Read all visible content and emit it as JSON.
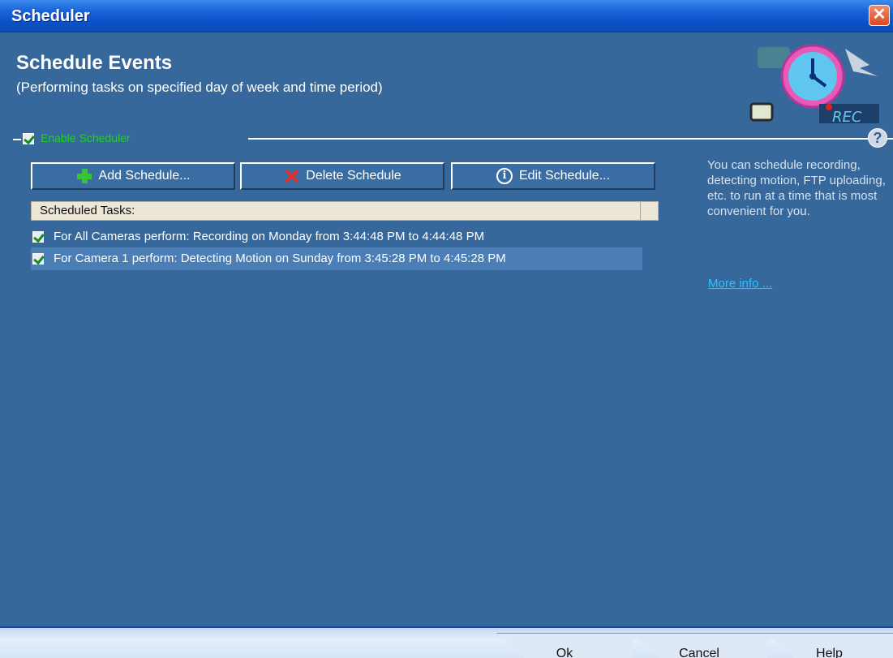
{
  "window": {
    "title": "Scheduler",
    "close_label": "✕"
  },
  "header": {
    "title": "Schedule Events",
    "subtitle": "(Performing tasks on specified day of week and time period)",
    "art_badge": "REC"
  },
  "enable_scheduler": {
    "label": "Enable Scheduler",
    "checked": true
  },
  "toolbar": {
    "add_label": "Add Schedule...",
    "delete_label": "Delete Schedule",
    "edit_label": "Edit Schedule..."
  },
  "task_list": {
    "header": "Scheduled Tasks:",
    "items": [
      {
        "text": "For All Cameras perform: Recording on Monday from 3:44:48 PM to 4:44:48 PM",
        "checked": true,
        "selected": false
      },
      {
        "text": "For Camera 1 perform: Detecting Motion on Sunday from 3:45:28 PM to 4:45:28 PM",
        "checked": true,
        "selected": true
      }
    ]
  },
  "side_help": {
    "icon": "?",
    "text": "You can schedule recording, detecting motion, FTP uploading, etc. to run at a time that is most convenient for you.",
    "link": "More info ..."
  },
  "footer": {
    "ok_label": "Ok",
    "cancel_label": "Cancel",
    "help_label": "Help"
  },
  "colors": {
    "background": "#36689b",
    "title_bar": "#0a52c9",
    "enable_label": "#1fd21f",
    "link": "#29c5ff"
  }
}
